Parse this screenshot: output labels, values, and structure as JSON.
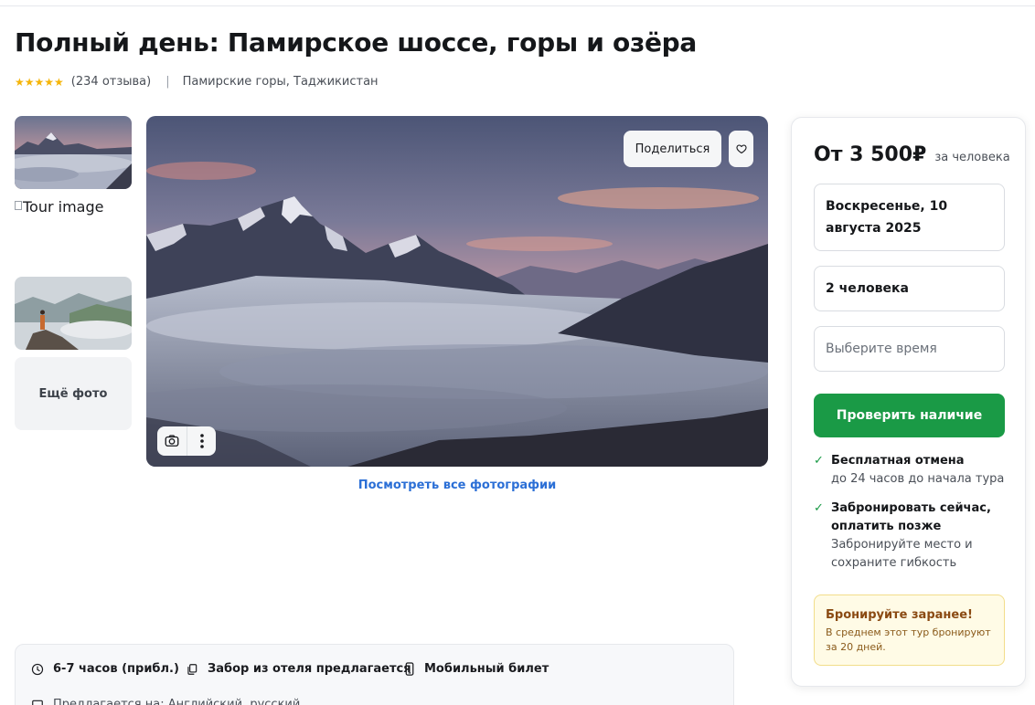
{
  "tour": {
    "title": "Полный день: Памирское шоссе, горы и озёра",
    "stars": "★★★★★",
    "reviews": "(234 отзыва)",
    "separator": "|",
    "location": "Памирские горы, Таджикистан"
  },
  "gallery": {
    "broken_image_alt": "Tour image",
    "more_photos_label": "Ещё фото",
    "share_label": "Поделиться",
    "view_all_label": "Посмотреть все фотографии"
  },
  "booking": {
    "price": "От 3 500₽",
    "per_person": "за человека",
    "date": "Воскресенье, 10 августа 2025",
    "people": "2 человека",
    "time_placeholder": "Выберите время",
    "check_button": "Проверить наличие",
    "benefits": [
      {
        "title": "Бесплатная отмена",
        "text": "до 24 часов до начала тура"
      },
      {
        "title": "Забронировать сейчас, оплатить позже",
        "text": "Забронируйте место и сохраните гибкость"
      }
    ],
    "notice_title": "Бронируйте заранее!",
    "notice_text": "В среднем этот тур бронируют за 20 дней."
  },
  "features": {
    "duration": "6-7 часов (прибл.)",
    "pickup": "Забор из отеля предлагается",
    "ticket": "Мобильный билет",
    "language": "Предлагается на: Английский, русский"
  },
  "colors": {
    "accent_green": "#1a9a46",
    "link_blue": "#2b6fd6",
    "star_yellow": "#f5b50a",
    "notice_bg": "#fffbe6"
  },
  "icons": {
    "check": "✓",
    "favorite": "heart-icon",
    "camera": "camera-icon",
    "more": "more-vertical-icon",
    "clock": "clock-icon",
    "copy": "copy-icon",
    "phone": "phone-icon",
    "language": "language-icon"
  }
}
